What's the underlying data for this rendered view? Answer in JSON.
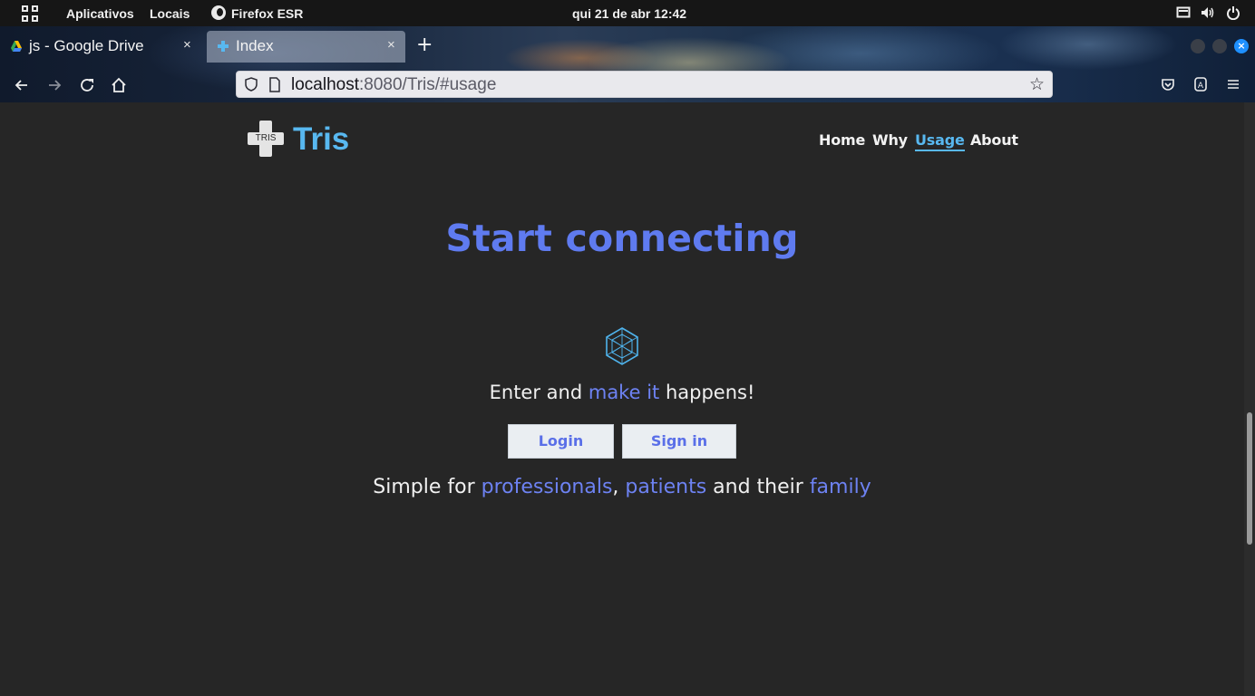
{
  "system_bar": {
    "apps_label": "Aplicativos",
    "places_label": "Locais",
    "active_app": "Firefox ESR",
    "clock": "qui 21 de abr  12:42"
  },
  "browser": {
    "tabs": [
      {
        "title": "js - Google Drive",
        "close": "×"
      },
      {
        "title": "Index",
        "close": "×"
      }
    ],
    "new_tab": "+",
    "url_host": "localhost",
    "url_rest": ":8080/Tris/#usage",
    "window_close": "×"
  },
  "site": {
    "logo_mark_text": "TRIS",
    "logo_name": "Tris",
    "nav": [
      "Home",
      "Why",
      "Usage",
      "About"
    ],
    "active_nav": "Usage",
    "headline": "Start connecting",
    "tagline_pre": "Enter and ",
    "tagline_accent": "make it",
    "tagline_post": " happens!",
    "login_label": "Login",
    "signin_label": "Sign in",
    "subline": {
      "prefix": "Simple for ",
      "word1": "professionals",
      "sep": ", ",
      "word2": "patients",
      "middle": " and their ",
      "word3": "family"
    }
  },
  "colors": {
    "accent_blue": "#58b8f0",
    "accent_indigo": "#5f7bf0",
    "page_bg": "#262626"
  }
}
